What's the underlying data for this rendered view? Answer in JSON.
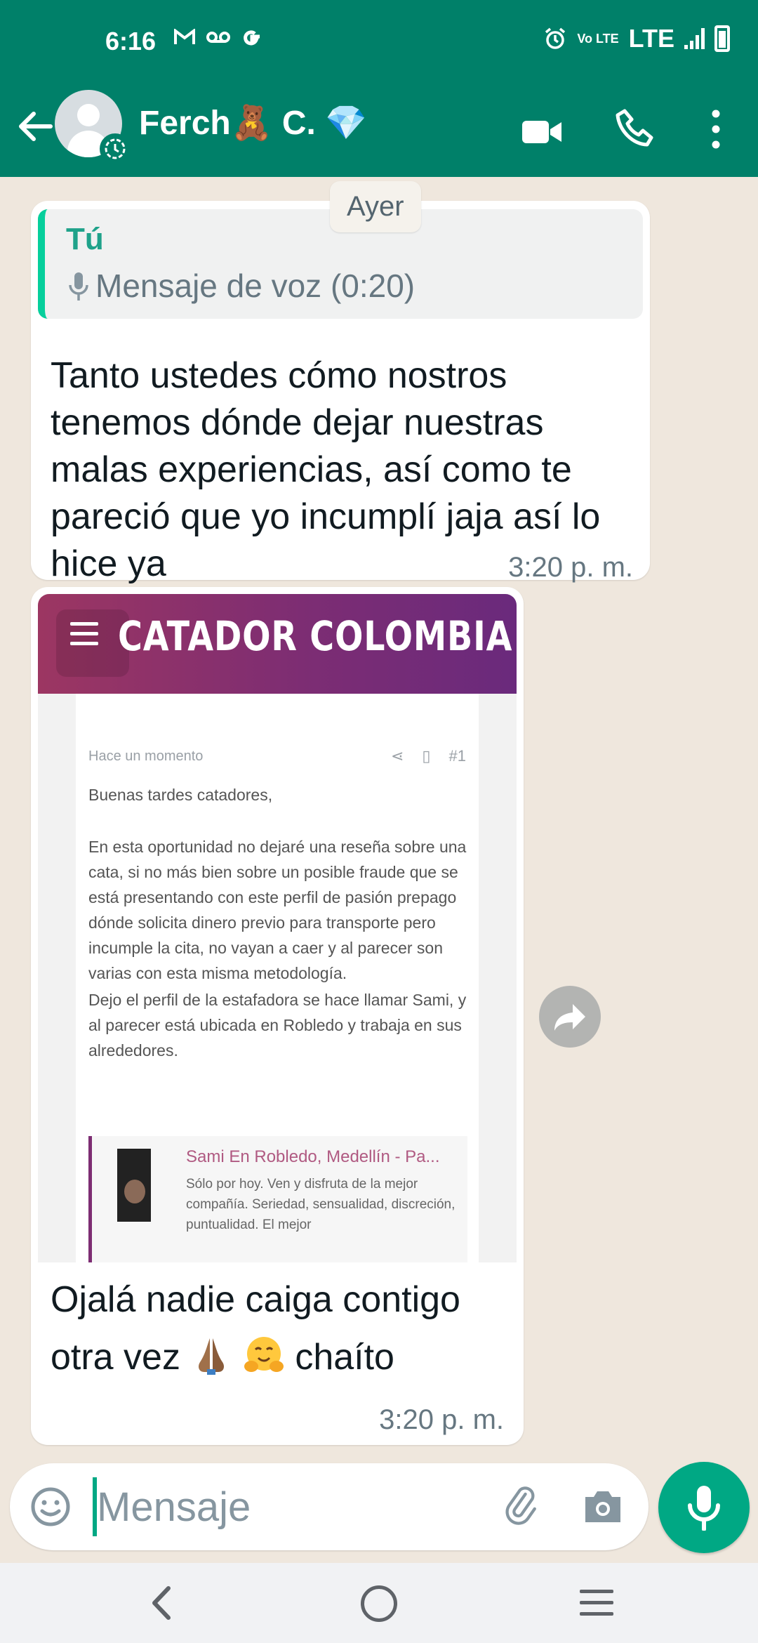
{
  "status_bar": {
    "time": "6:16",
    "left_icons": [
      "gmail-icon",
      "voicemail-icon",
      "google-icon"
    ],
    "network": "LTE",
    "volte": "Vo LTE"
  },
  "header": {
    "contact_name": "Ferch🧸 C. 💎",
    "accent_color": "#008069"
  },
  "chat": {
    "date_chip": "Ayer",
    "messages": [
      {
        "quote_author": "Tú",
        "quote_text": "Mensaje de voz (0:20)",
        "text": "Tanto ustedes cómo nostros tenemos dónde dejar nuestras malas experiencias, así como te pareció que yo incumplí jaja así lo hice ya",
        "time": "3:20 p. m."
      },
      {
        "image": {
          "site_title": "CATADOR COLOMBIA",
          "post_meta": "Hace un momento",
          "post_number": "#1",
          "greeting": "Buenas tardes catadores,",
          "paragraph1": "En esta oportunidad no dejaré una reseña sobre una cata, si no más bien sobre un posible fraude que se está presentando con este perfil de pasión prepago dónde solicita dinero previo para transporte pero incumple la cita, no vayan a caer y al parecer son varias con esta misma metodología.",
          "paragraph2": "Dejo el perfil de la estafadora se hace llamar Sami, y al parecer está ubicada en Robledo y trabaja en sus alrededores.",
          "link_title": "Sami En Robledo, Medellín - Pa...",
          "link_desc": "Sólo por hoy. Ven y disfruta de la mejor compañía. Seriedad, sensualidad, discreción, puntualidad. El mejor"
        },
        "text_before_emoji": "Ojalá nadie caiga contigo otra vez ",
        "text_after_emoji": " chaíto",
        "time": "3:20 p. m."
      }
    ]
  },
  "input": {
    "placeholder": "Mensaje"
  }
}
